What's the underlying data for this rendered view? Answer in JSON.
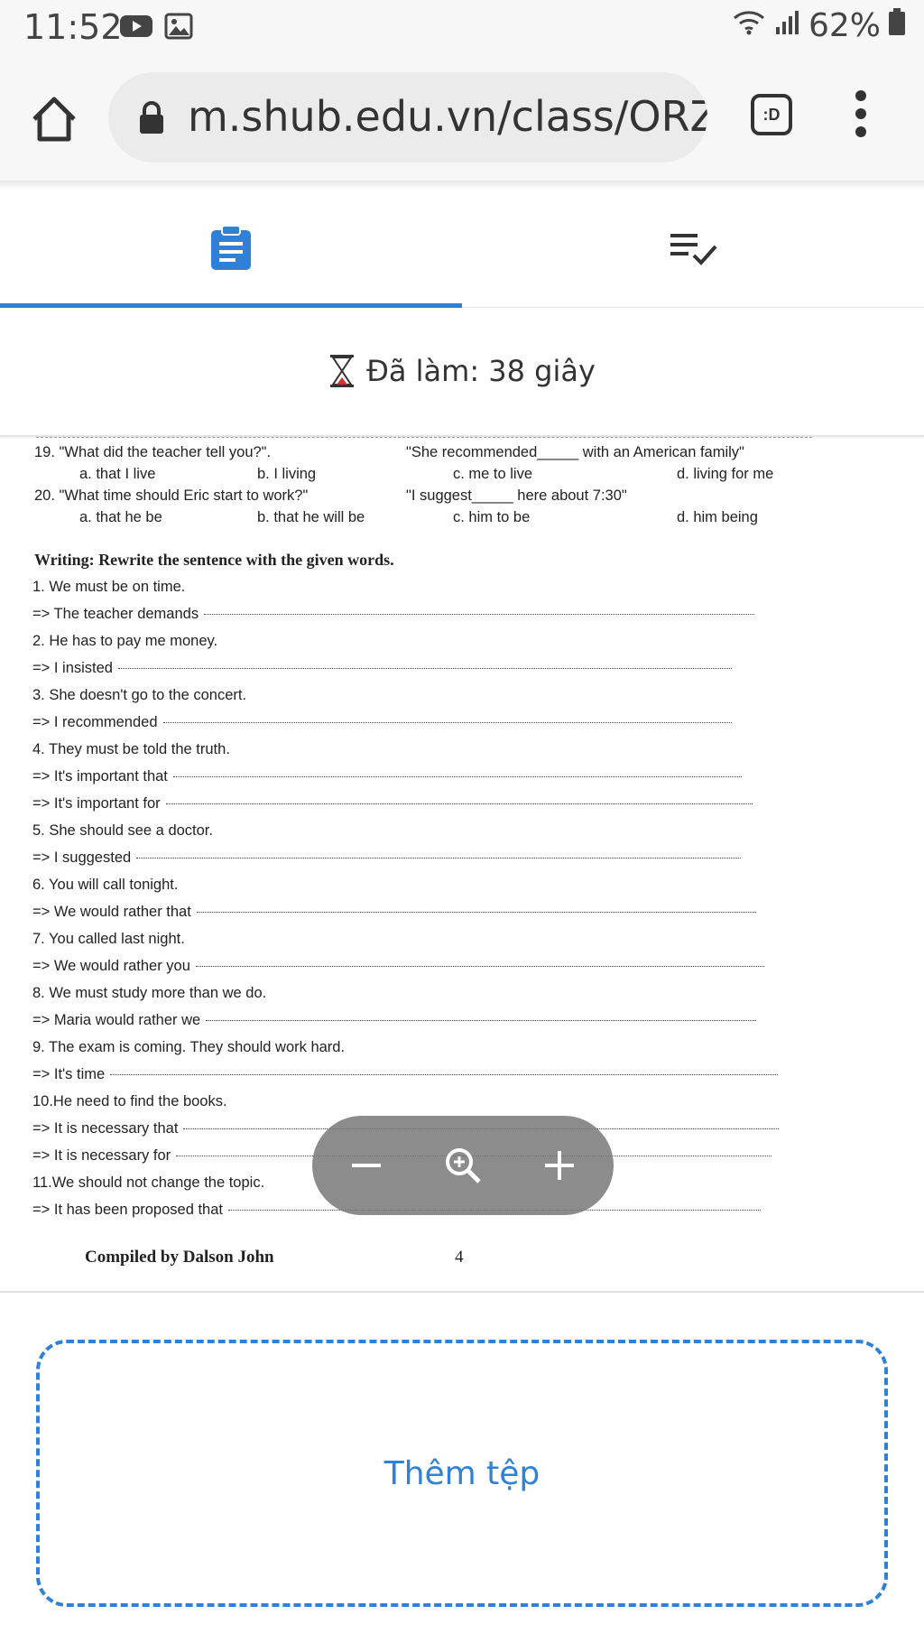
{
  "status_bar": {
    "time": "11:52",
    "battery": "62%",
    "icons": [
      "youtube-icon",
      "image-icon",
      "wifi-icon",
      "signal-icon",
      "battery-icon"
    ]
  },
  "browser": {
    "url": "m.shub.edu.vn/class/ORZ",
    "tabs_label": ":D"
  },
  "tabs": [
    {
      "name": "assignment",
      "icon": "clipboard-icon",
      "active": true
    },
    {
      "name": "answers",
      "icon": "checklist-icon",
      "active": false
    }
  ],
  "timer": {
    "label": "Đã làm: 38 giây"
  },
  "document": {
    "questions": [
      {
        "prompt": "19. \"What did the teacher tell you?\".",
        "reply": "\"She recommended_____ with an American family\"",
        "options": [
          "a. that I live",
          "b. I living",
          "c. me to live",
          "d. living for me"
        ]
      },
      {
        "prompt": "20. \"What time should Eric start to work?\"",
        "reply": "\"I suggest_____ here about 7:30\"",
        "options": [
          "a. that he be",
          "b. that he will be",
          "c. him to be",
          "d. him being"
        ]
      }
    ],
    "writing_heading": "Writing: Rewrite the sentence with the given words.",
    "writing_lines": [
      "1.  We must be on time.",
      "=> The teacher demands",
      "2.  He has to pay me money.",
      "=> I insisted",
      "3.  She doesn't go to the concert.",
      "=> I recommended",
      "4.  They must be told the truth.",
      "=> It's important that",
      "=> It's important for",
      "5.  She should see a doctor.",
      "=> I suggested",
      "6.  You will call tonight.",
      "=> We would rather that",
      "7.  You called last night.",
      "=> We would rather you",
      "8.  We must study more than we do.",
      "=> Maria would rather we",
      "9.  The exam is coming. They should work hard.",
      "=> It's time",
      "10.He need to find the books.",
      "=> It is necessary that",
      "=> It is necessary for",
      "11.We should not change the topic.",
      "=> It has been proposed that"
    ],
    "footer": {
      "compiled_by": "Compiled by Dalson John",
      "page": "4"
    }
  },
  "zoom_controls": {
    "icons": [
      "minus-icon",
      "zoom-icon",
      "plus-icon"
    ]
  },
  "upload": {
    "label": "Thêm tệp"
  },
  "colors": {
    "accent": "#2f80d8",
    "zoom_bg": "#7a7a7a"
  }
}
